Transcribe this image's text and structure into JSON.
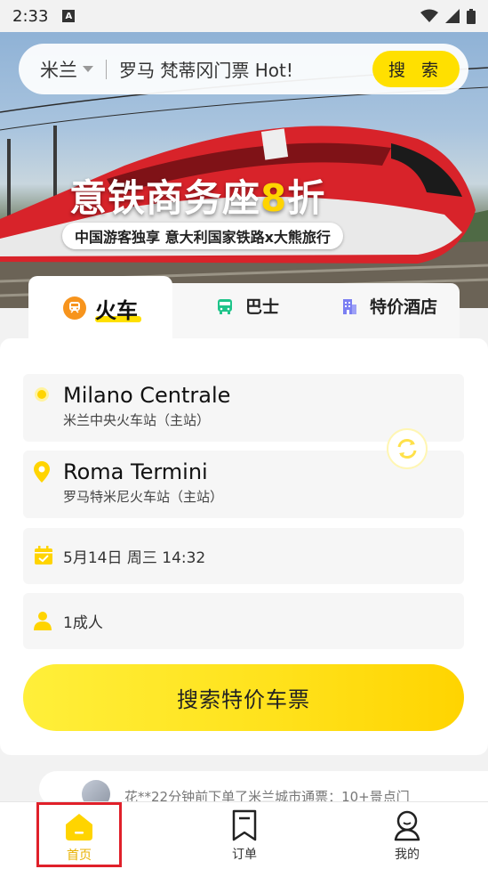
{
  "status_bar": {
    "time": "2:33",
    "notification_letter": "A"
  },
  "search": {
    "city": "米兰",
    "placeholder": "罗马 梵蒂冈门票 Hot!",
    "button_label": "搜 索"
  },
  "banner": {
    "title_main": "意铁商务座",
    "title_highlight": "8",
    "title_end": "折",
    "subtitle": "中国游客独享 意大利国家铁路x大熊旅行"
  },
  "tabs": [
    {
      "label": "火车",
      "icon": "train-icon",
      "active": true
    },
    {
      "label": "巴士",
      "icon": "bus-icon",
      "active": false
    },
    {
      "label": "特价酒店",
      "icon": "hotel-icon",
      "active": false
    }
  ],
  "form": {
    "from": {
      "name": "Milano Centrale",
      "sub": "米兰中央火车站（主站）"
    },
    "to": {
      "name": "Roma Termini",
      "sub": "罗马特米尼火车站（主站）"
    },
    "date": "5月14日 周三 14:32",
    "passengers": "1成人",
    "submit_label": "搜索特价车票"
  },
  "ticker": {
    "text": "花**22分钟前下单了米兰城市通票：10+景点门"
  },
  "bottom_nav": [
    {
      "label": "首页",
      "icon": "home-icon",
      "active": true
    },
    {
      "label": "订单",
      "icon": "bookmark-icon",
      "active": false
    },
    {
      "label": "我的",
      "icon": "person-icon",
      "active": false
    }
  ],
  "colors": {
    "accent": "#ffe000",
    "highlight_border": "#e0202a",
    "train_red": "#d8232a"
  }
}
